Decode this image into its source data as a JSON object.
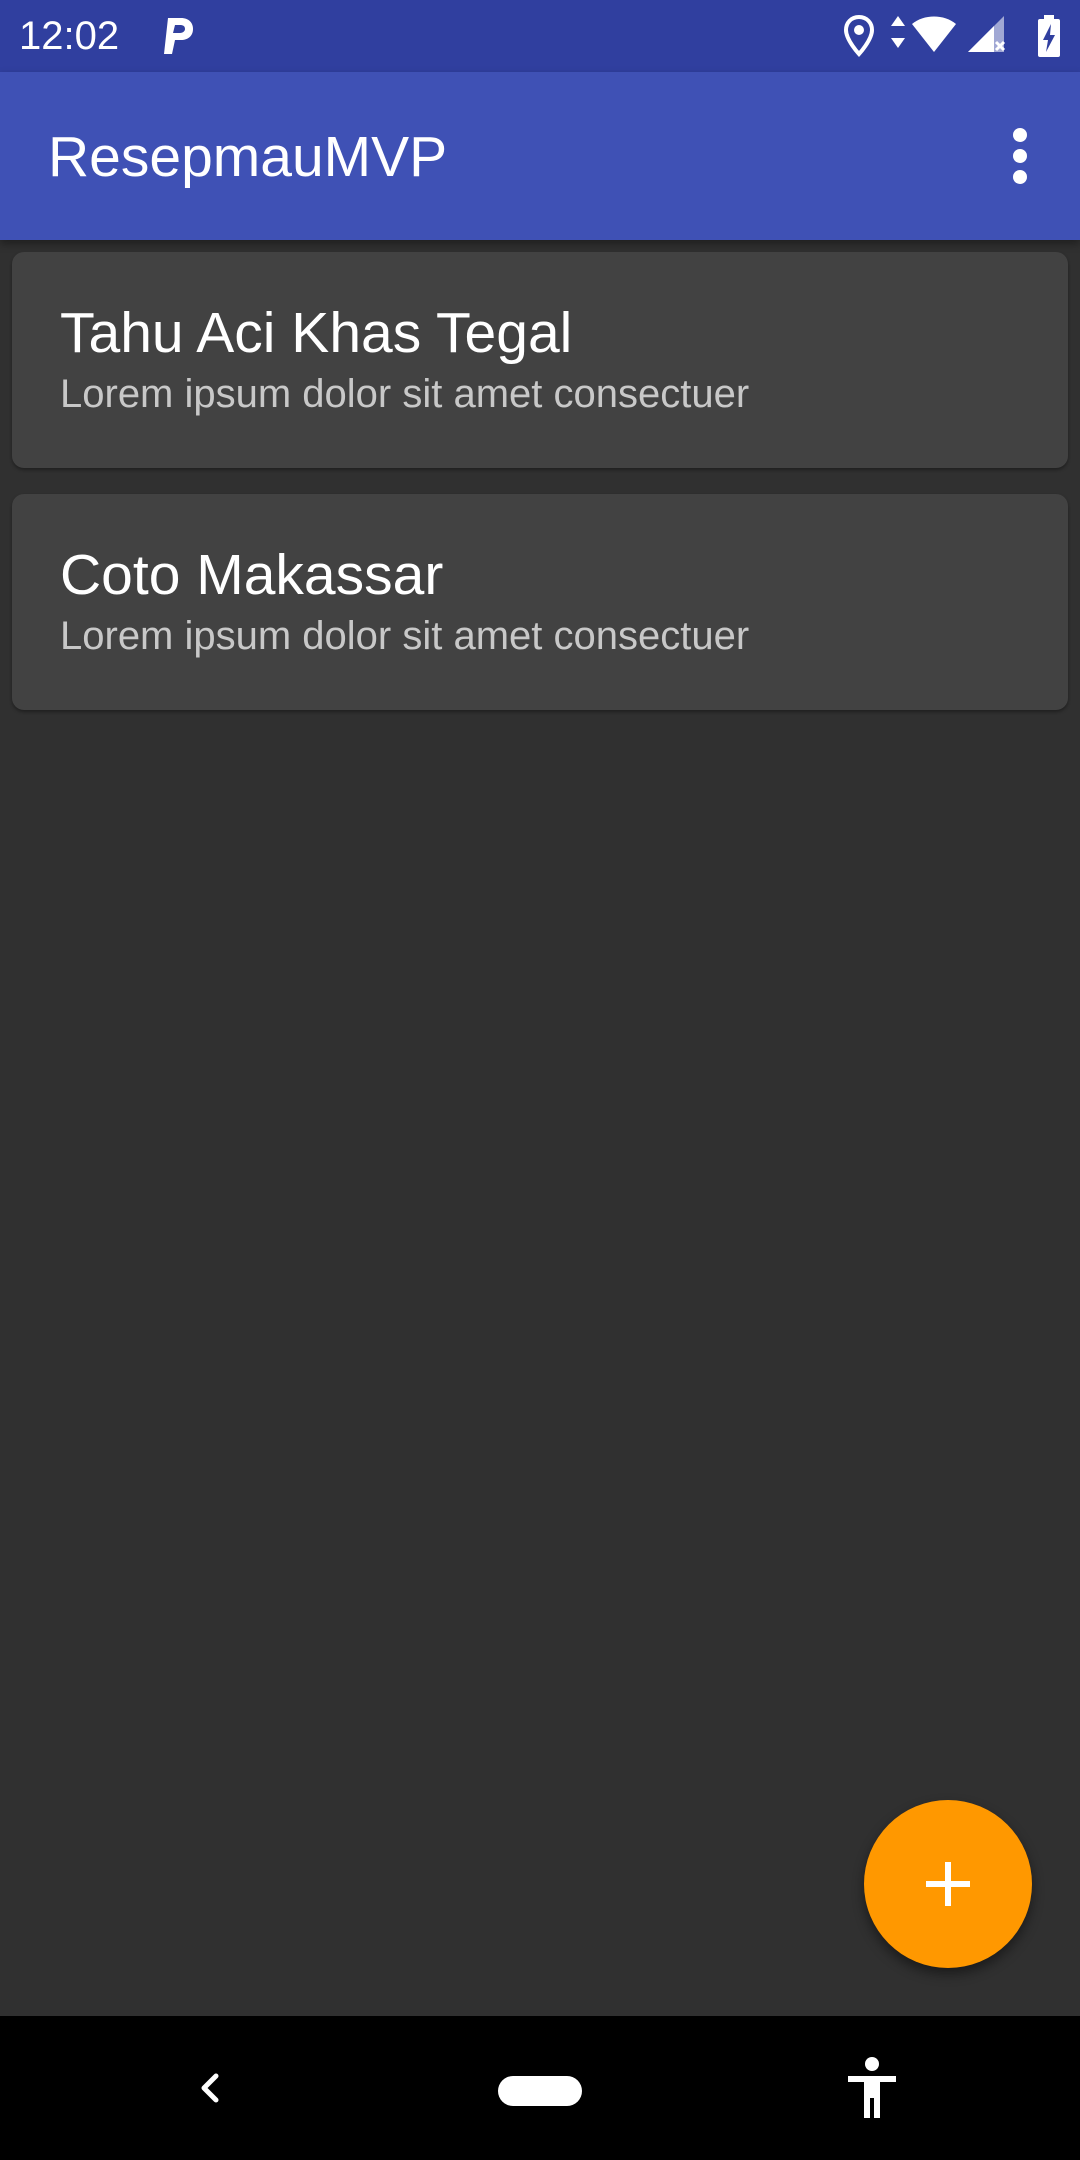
{
  "status_bar": {
    "time": "12:02",
    "icons": [
      "parking-icon",
      "location-icon",
      "data-arrows-icon",
      "wifi-icon",
      "cell-signal-icon",
      "battery-charging-icon"
    ]
  },
  "app_bar": {
    "title": "ResepmauMVP",
    "menu_icon": "more-vert-icon"
  },
  "recipes": [
    {
      "title": "Tahu Aci Khas Tegal",
      "description": "Lorem ipsum dolor sit amet consectuer"
    },
    {
      "title": "Coto Makassar",
      "description": "Lorem ipsum dolor sit amet consectuer"
    }
  ],
  "fab": {
    "icon": "add-icon",
    "color": "#FF9800"
  },
  "nav_bar": {
    "icons": [
      "back-icon",
      "home-pill-icon",
      "accessibility-icon"
    ]
  },
  "colors": {
    "status_bar": "#303F9F",
    "app_bar": "#3F51B5",
    "background": "#303030",
    "card": "#424242"
  }
}
